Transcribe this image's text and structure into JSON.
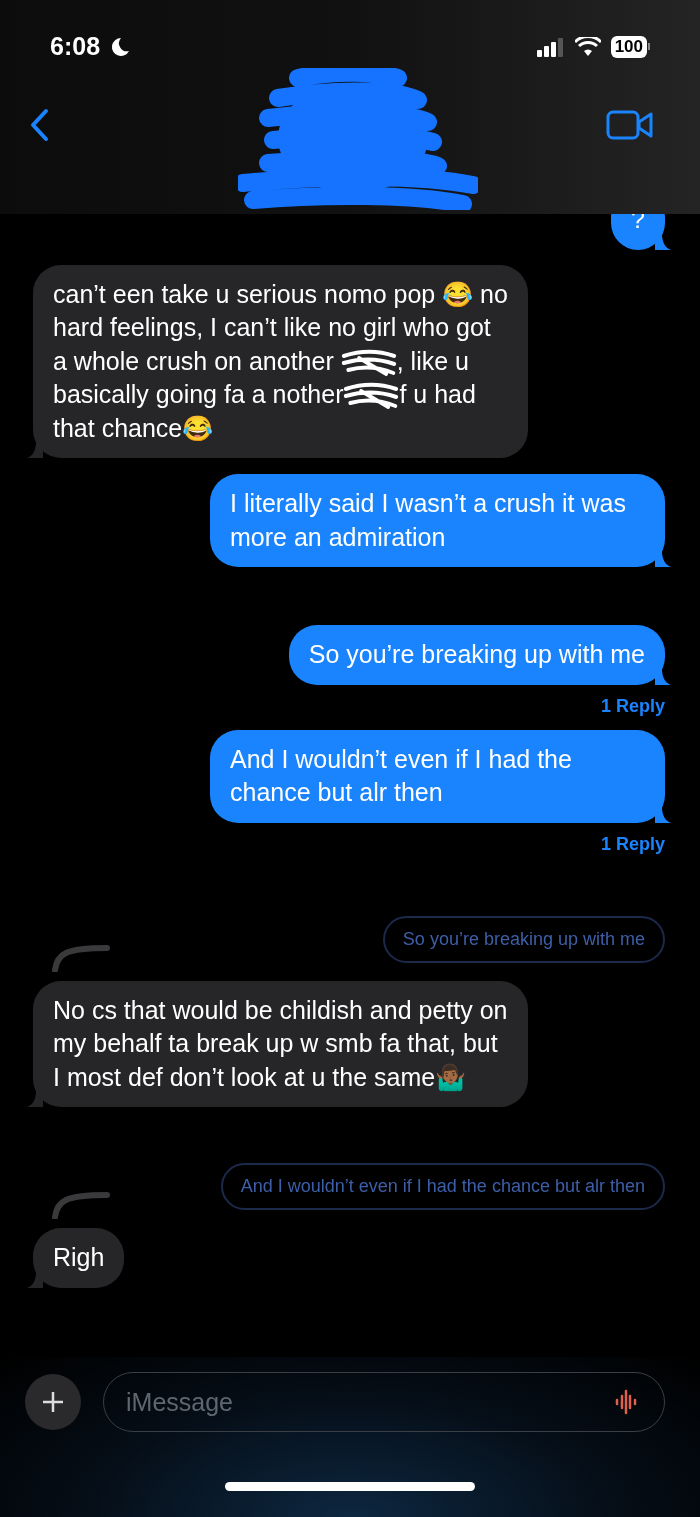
{
  "status_bar": {
    "time": "6:08",
    "battery": "100"
  },
  "messages": [
    {
      "kind": "outgoing",
      "segments": [
        {
          "kind": "text",
          "text": "?"
        }
      ]
    },
    {
      "kind": "incoming",
      "segments": [
        {
          "kind": "text",
          "text": "can’t een take u serious nomo pop 😂 no hard feelings, I can’t like no girl who got a whole crush on another "
        },
        {
          "kind": "redaction"
        },
        {
          "kind": "text",
          "text": ", like u basically going fa a nother"
        },
        {
          "kind": "redaction"
        },
        {
          "kind": "text",
          "text": "f u had that chance😂"
        }
      ]
    },
    {
      "kind": "outgoing",
      "segments": [
        {
          "kind": "text",
          "text": "I literally said I wasn’t a crush it was more an admiration"
        }
      ]
    },
    {
      "kind": "outgoing",
      "segments": [
        {
          "kind": "text",
          "text": "So you’re breaking up with me"
        }
      ],
      "replies": "1 Reply"
    },
    {
      "kind": "outgoing",
      "segments": [
        {
          "kind": "text",
          "text": "And I wouldn’t even if I had the chance but alr then"
        }
      ],
      "replies": "1 Reply"
    },
    {
      "kind": "quote",
      "text": "So you’re breaking up with me"
    },
    {
      "kind": "incoming",
      "segments": [
        {
          "kind": "text",
          "text": "No cs that would be childish and petty on my behalf ta break up w smb fa that, but I most def don’t look at u the same🤷🏾‍♂️"
        }
      ]
    },
    {
      "kind": "quote",
      "text": "And I wouldn’t even if I had the chance but alr then"
    },
    {
      "kind": "incoming",
      "segments": [
        {
          "kind": "text",
          "text": "Righ"
        }
      ]
    }
  ],
  "composer": {
    "placeholder": "iMessage"
  }
}
